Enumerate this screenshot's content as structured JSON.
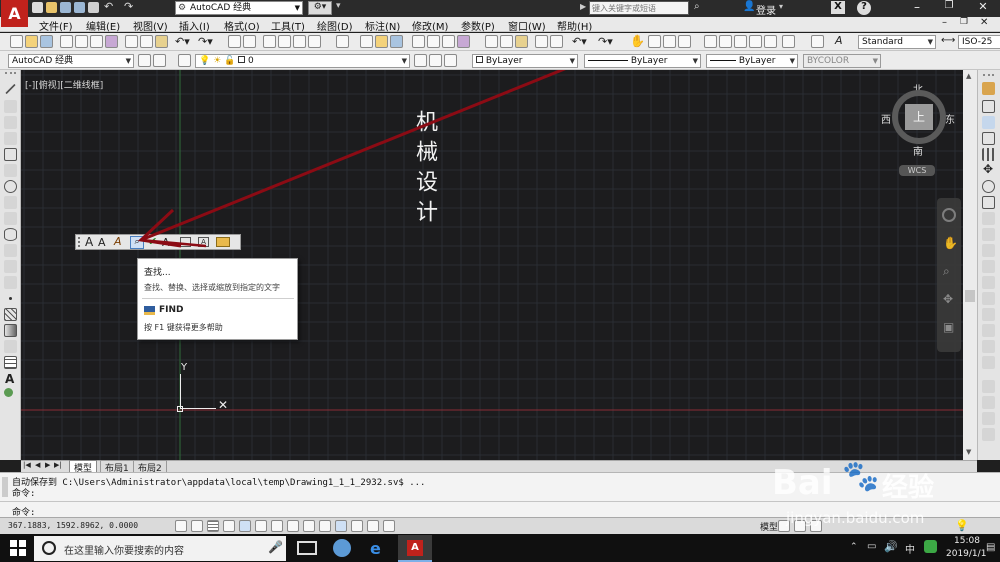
{
  "window": {
    "workspace_title": "AutoCAD 经典",
    "search_placeholder": "键入关键字或短语",
    "login_label": "登录",
    "help_label": "?"
  },
  "menubar": {
    "items": [
      "文件(F)",
      "编辑(E)",
      "视图(V)",
      "插入(I)",
      "格式(O)",
      "工具(T)",
      "绘图(D)",
      "标注(N)",
      "修改(M)",
      "参数(P)",
      "窗口(W)",
      "帮助(H)"
    ]
  },
  "toolbars": {
    "text_style": "Standard",
    "dim_style": "ISO-25",
    "workspace_combo": "AutoCAD 经典",
    "layer_combo": "0",
    "color_combo": "ByLayer",
    "linetype_combo": "ByLayer",
    "lineweight_combo": "ByLayer",
    "plotstyle_combo": "BYCOLOR"
  },
  "canvas": {
    "viewport_label": "[-][俯视][二维线框]",
    "drawing_text": "机械设计",
    "ucs_y": "Y",
    "grid_color": "#2a2d33",
    "axis_red": "#8a2d35",
    "axis_green": "#2f6b3a",
    "arrow_color": "#8b0b14"
  },
  "viewcube": {
    "north": "北",
    "south": "南",
    "east": "东",
    "west": "西",
    "top": "上",
    "wcs": "WCS"
  },
  "text_toolbar": {
    "buttons": [
      "A",
      "A",
      "A"
    ]
  },
  "tooltip": {
    "title": "查找...",
    "description": "查找、替换、选择或缩放到指定的文字",
    "command": "FIND",
    "help_hint": "按 F1 键获得更多帮助"
  },
  "layout_tabs": {
    "tabs": [
      "模型",
      "布局1",
      "布局2"
    ]
  },
  "command_line": {
    "history_1": "自动保存到 C:\\Users\\Administrator\\appdata\\local\\temp\\Drawing1_1_1_2932.sv$ ...",
    "history_2": "命令:",
    "prompt": "命令:"
  },
  "status_bar": {
    "coordinates": "367.1883,  1592.8962, 0.0000",
    "model_label": "模型"
  },
  "taskbar": {
    "search_placeholder": "在这里输入你要搜索的内容",
    "time": "15:08",
    "date": "2019/1/1",
    "ime": "中"
  },
  "watermark": {
    "brand": "Bai",
    "brand_cn": "经验",
    "url": "jingyan.baidu.com"
  }
}
